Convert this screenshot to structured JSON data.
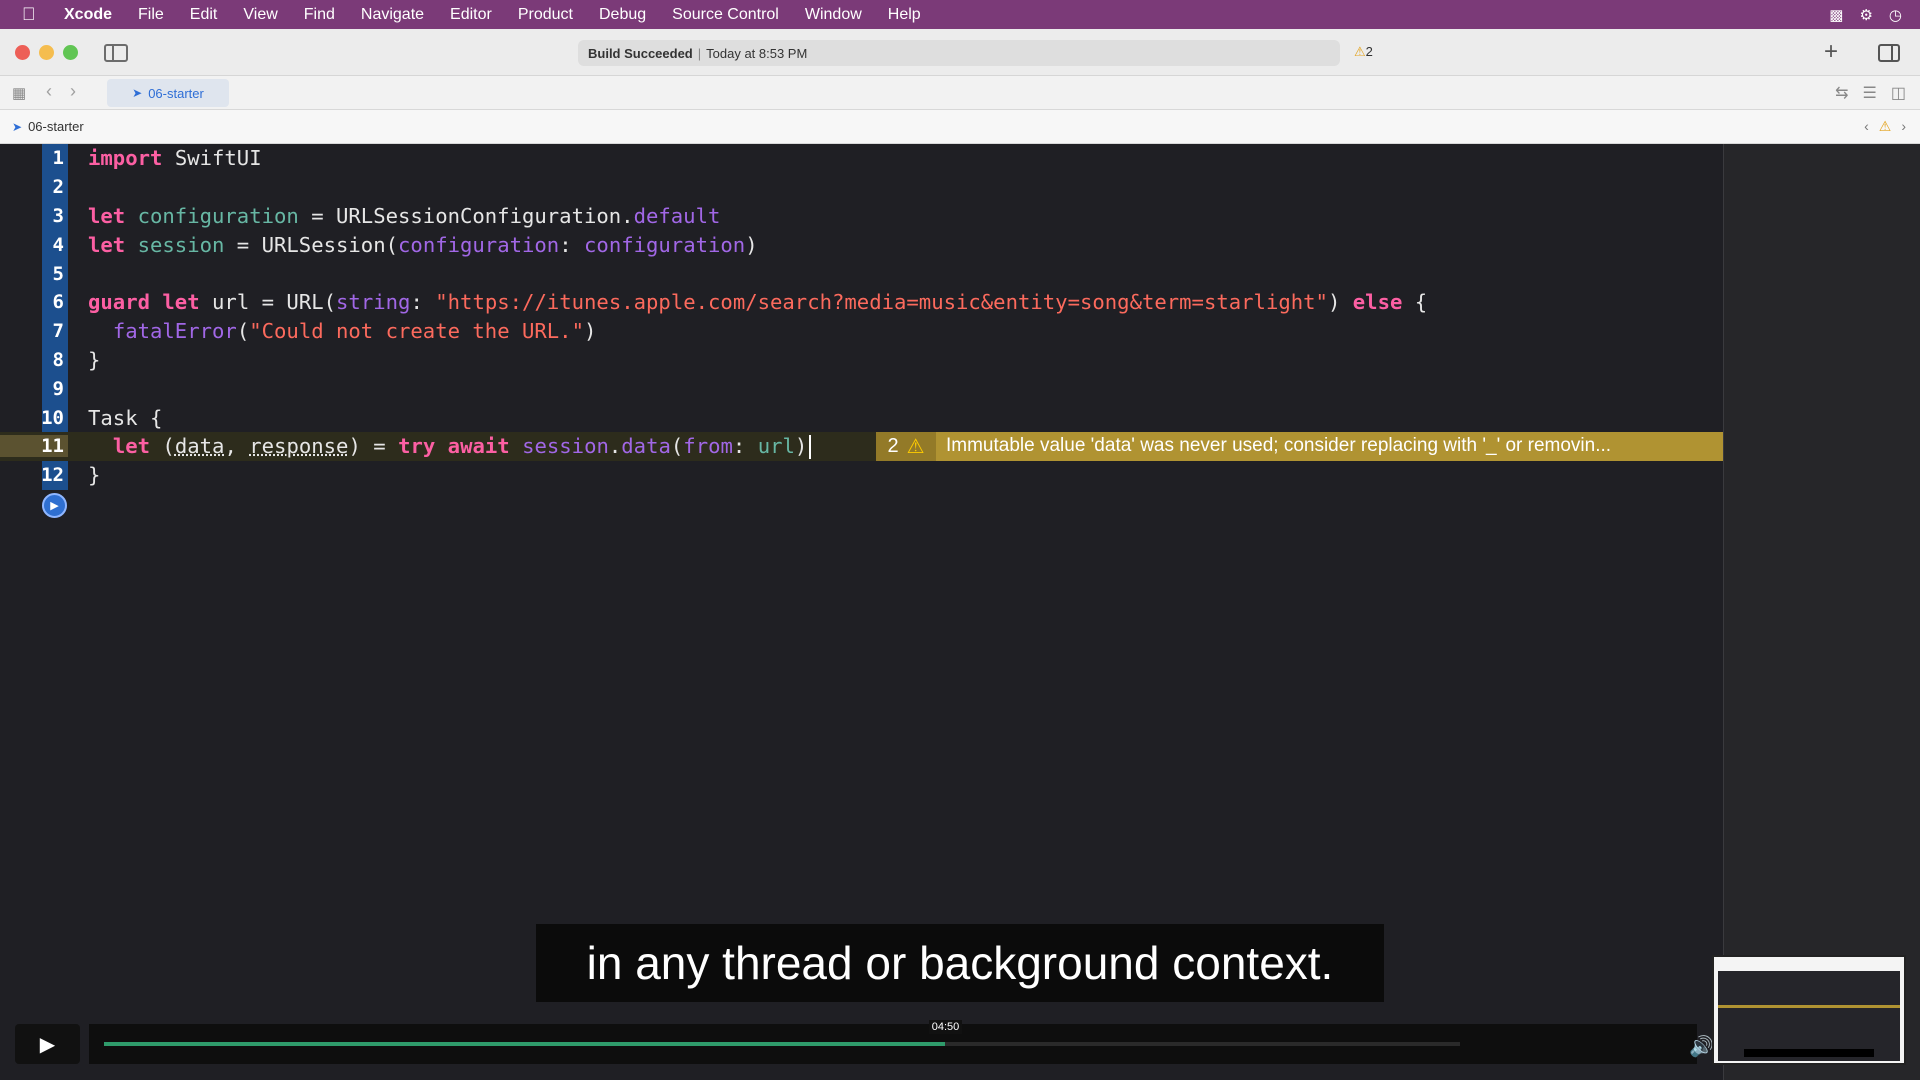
{
  "menubar": {
    "apple": "",
    "items": [
      "Xcode",
      "File",
      "Edit",
      "View",
      "Find",
      "Navigate",
      "Editor",
      "Product",
      "Debug",
      "Source Control",
      "Window",
      "Help"
    ]
  },
  "toolbar": {
    "status_bold": "Build Succeeded",
    "status_time": "Today at 8:53 PM",
    "warning_count": "2"
  },
  "tabbar": {
    "tab_label": "06-starter"
  },
  "jumpbar": {
    "path": "06-starter"
  },
  "editor": {
    "line_numbers": [
      "1",
      "2",
      "3",
      "4",
      "5",
      "6",
      "7",
      "8",
      "9",
      "10",
      "11",
      "12"
    ],
    "warning": {
      "count": "2",
      "message": "Immutable value 'data' was never used; consider replacing with '_' or removin..."
    }
  },
  "video": {
    "caption": "in any thread or background context.",
    "timestamp": "04:50",
    "progress": 0.62
  },
  "colors": {
    "menubar": "#7b3a78",
    "keyword": "#fc5fa3",
    "string": "#fc6a5d",
    "warning_banner": "#b09332",
    "progress": "#2f9b6b"
  }
}
